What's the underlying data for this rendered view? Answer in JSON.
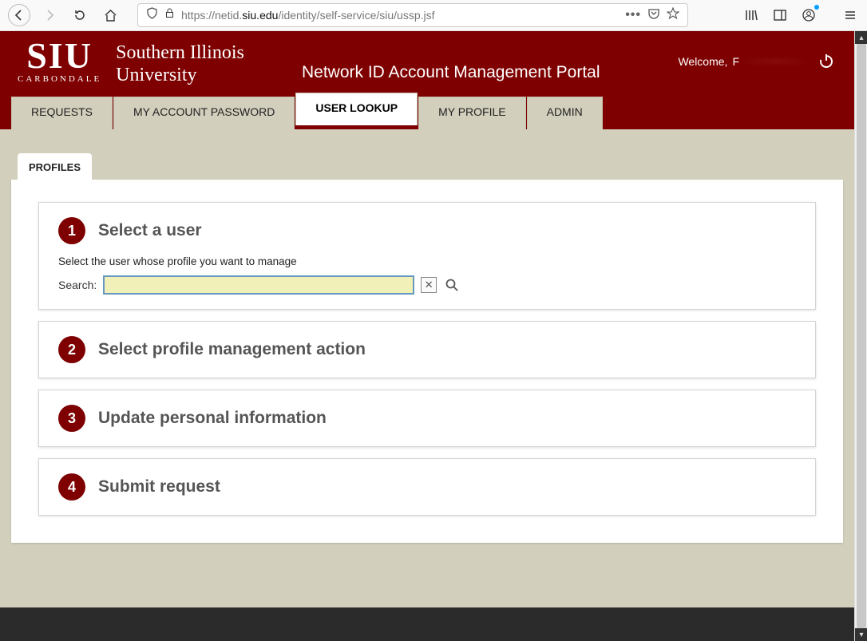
{
  "browser": {
    "url_prefix": "https://netid.",
    "url_domain": "siu.edu",
    "url_path": "/identity/self-service/siu/ussp.jsf"
  },
  "header": {
    "logo_big": "SIU",
    "logo_small": "CARBONDALE",
    "university_line1": "Southern Illinois",
    "university_line2": "University",
    "portal_title": "Network ID Account Management Portal",
    "welcome_label": "Welcome,",
    "welcome_initial": "F"
  },
  "tabs": {
    "items": [
      {
        "label": "REQUESTS",
        "active": false
      },
      {
        "label": "MY ACCOUNT PASSWORD",
        "active": false
      },
      {
        "label": "USER LOOKUP",
        "active": true
      },
      {
        "label": "MY PROFILE",
        "active": false
      },
      {
        "label": "ADMIN",
        "active": false
      }
    ]
  },
  "subtab": {
    "label": "PROFILES"
  },
  "steps": {
    "s1": {
      "num": "1",
      "title": "Select a user",
      "desc": "Select the user whose profile you want to manage",
      "search_label": "Search:",
      "search_value": "",
      "clear_glyph": "✕",
      "go_glyph": "🔍"
    },
    "s2": {
      "num": "2",
      "title": "Select profile management action"
    },
    "s3": {
      "num": "3",
      "title": "Update personal information"
    },
    "s4": {
      "num": "4",
      "title": "Submit request"
    }
  },
  "colors": {
    "brand": "#7e0000",
    "page_bg": "#d2cfbc"
  }
}
